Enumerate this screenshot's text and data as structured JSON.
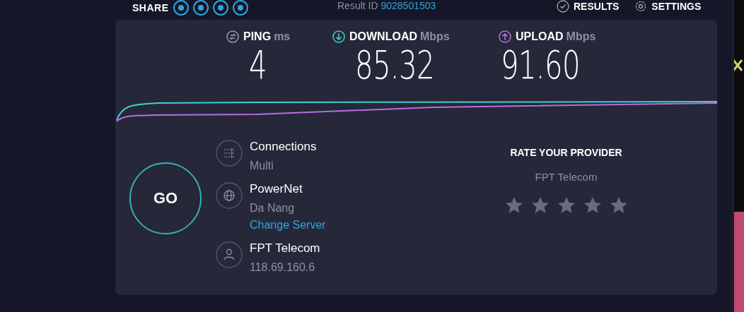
{
  "top_bar": {
    "share_label": "SHARE",
    "result_label": "Result ID",
    "result_id": "9028501503",
    "results_link": "RESULTS",
    "settings_link": "SETTINGS"
  },
  "metrics": [
    {
      "kind": "ping",
      "label": "PING",
      "unit": "ms",
      "value": "4",
      "color": "#9a9bb0"
    },
    {
      "kind": "download",
      "label": "DOWNLOAD",
      "unit": "Mbps",
      "value": "85.32",
      "color": "#3ed0d0"
    },
    {
      "kind": "upload",
      "label": "UPLOAD",
      "unit": "Mbps",
      "value": "91.60",
      "color": "#b76ee0"
    }
  ],
  "go_button": "GO",
  "info": [
    {
      "kind": "connections",
      "title": "Connections",
      "detail": "Multi"
    },
    {
      "kind": "server",
      "title": "PowerNet",
      "detail": "Da Nang",
      "link": "Change Server"
    },
    {
      "kind": "isp",
      "title": "FPT Telecom",
      "detail": "118.69.160.6"
    }
  ],
  "rating": {
    "title": "RATE YOUR PROVIDER",
    "provider": "FPT Telecom",
    "stars": 0
  }
}
